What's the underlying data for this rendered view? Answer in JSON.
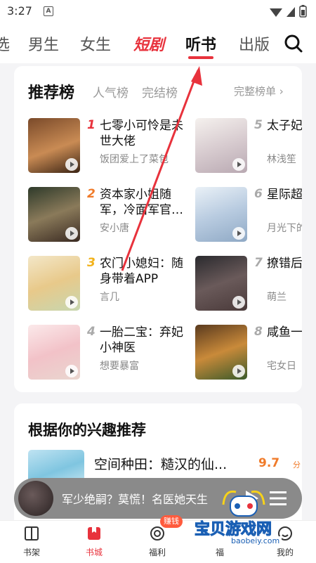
{
  "status": {
    "time": "3:27",
    "badge": "A"
  },
  "tabs": [
    {
      "label": "选",
      "style": "normal"
    },
    {
      "label": "男生",
      "style": "normal"
    },
    {
      "label": "女生",
      "style": "normal"
    },
    {
      "label": "短剧",
      "style": "red"
    },
    {
      "label": "听书",
      "style": "active"
    },
    {
      "label": "出版",
      "style": "normal"
    }
  ],
  "ranking": {
    "title": "推荐榜",
    "tabs": [
      "人气榜",
      "完结榜"
    ],
    "more": "完整榜单 ›",
    "books": [
      {
        "rank": "1",
        "title": "七零小可怜是未世大佬",
        "author": "饭团爱上了菜包"
      },
      {
        "rank": "2",
        "title": "资本家小姐随军，冷面军官…",
        "author": "安小唐"
      },
      {
        "rank": "3",
        "title": "农门小媳妇：随身带着APP",
        "author": "言几"
      },
      {
        "rank": "4",
        "title": "一胎二宝：弃妃小神医",
        "author": "想要暴富"
      },
      {
        "rank": "5",
        "title": "太子妃佬",
        "author": "林浅笙"
      },
      {
        "rank": "6",
        "title": "星际超",
        "author": "月光下的"
      },
      {
        "rank": "7",
        "title": "撩错后男小叔",
        "author": "萌兰"
      },
      {
        "rank": "8",
        "title": "咸鱼一生活",
        "author": "宅女日"
      }
    ]
  },
  "interest": {
    "title": "根据你的兴趣推荐",
    "book": {
      "title": "空间种田：糙汉的仙...",
      "score": "9.7",
      "unit": "分"
    }
  },
  "player": {
    "title": "军少绝嗣？莫慌！名医她天生"
  },
  "nav": [
    {
      "label": "书架",
      "icon": "bookshelf-icon"
    },
    {
      "label": "书城",
      "icon": "bookstore-icon"
    },
    {
      "label": "福利",
      "icon": "welfare-icon",
      "badge": "赚钱"
    },
    {
      "label": "福",
      "icon": "hidden-icon"
    },
    {
      "label": "我的",
      "icon": "profile-icon"
    }
  ],
  "watermark": {
    "text": "宝贝游戏网",
    "url": "baobeiy.com"
  },
  "colors": {
    "accent": "#e8323c",
    "score": "#f07b2a",
    "player_bg": "#8a8a8a"
  }
}
